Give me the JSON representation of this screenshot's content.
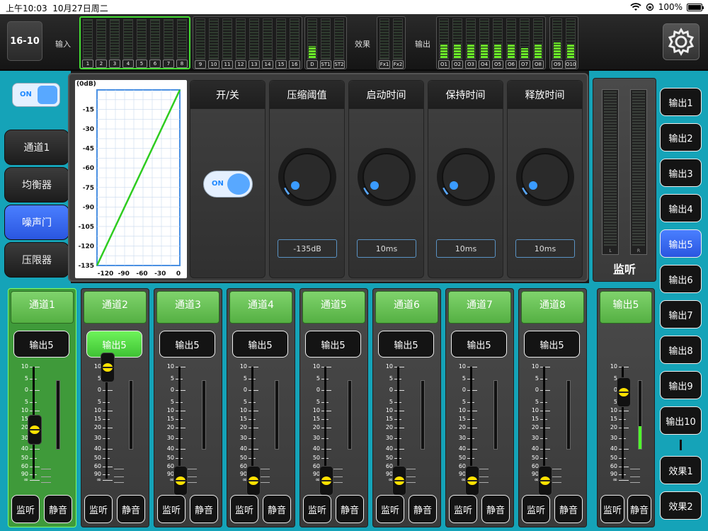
{
  "status": {
    "time": "上午10:03",
    "date": "10月27日周二",
    "battery": "100%"
  },
  "header": {
    "model": "16-10",
    "input_label": "输入",
    "fx_label": "效果",
    "output_label": "输出",
    "input_group1": [
      {
        "label": "1",
        "level": 0
      },
      {
        "label": "2",
        "level": 0
      },
      {
        "label": "3",
        "level": 0
      },
      {
        "label": "4",
        "level": 0
      },
      {
        "label": "5",
        "level": 0
      },
      {
        "label": "6",
        "level": 0
      },
      {
        "label": "7",
        "level": 0
      },
      {
        "label": "8",
        "level": 0
      }
    ],
    "input_group2": [
      {
        "label": "9",
        "level": 0
      },
      {
        "label": "10",
        "level": 0
      },
      {
        "label": "11",
        "level": 0
      },
      {
        "label": "12",
        "level": 0
      },
      {
        "label": "13",
        "level": 0
      },
      {
        "label": "14",
        "level": 0
      },
      {
        "label": "15",
        "level": 0
      },
      {
        "label": "16",
        "level": 0
      }
    ],
    "input_group3": [
      {
        "label": "D",
        "level": 0.3
      },
      {
        "label": "ST1",
        "level": 0
      },
      {
        "label": "ST2",
        "level": 0
      }
    ],
    "fx_group": [
      {
        "label": "Fx1",
        "level": 0
      },
      {
        "label": "Fx2",
        "level": 0
      }
    ],
    "output_group1": [
      {
        "label": "O1",
        "level": 0.35
      },
      {
        "label": "O2",
        "level": 0.35
      },
      {
        "label": "O3",
        "level": 0.35
      },
      {
        "label": "O4",
        "level": 0.35
      },
      {
        "label": "O5",
        "level": 0.35
      },
      {
        "label": "O6",
        "level": 0.35
      },
      {
        "label": "O7",
        "level": 0.25
      },
      {
        "label": "O8",
        "level": 0.35
      }
    ],
    "output_group2": [
      {
        "label": "O9",
        "level": 0.4
      },
      {
        "label": "O10",
        "level": 0.35
      }
    ]
  },
  "left_nav": {
    "toggle_label": "ON",
    "items": [
      "通道1",
      "均衡器",
      "噪声门",
      "压限器"
    ],
    "active_index": 2
  },
  "graph": {
    "y_ticks": [
      "(0dB)",
      "-15",
      "-30",
      "-45",
      "-60",
      "-75",
      "-90",
      "-105",
      "-120",
      "-135"
    ],
    "x_ticks": [
      "-120",
      "-90",
      "-60",
      "-30",
      "0"
    ]
  },
  "params": {
    "onoff_title": "开/关",
    "onoff_toggle": "ON",
    "knobs": [
      {
        "title": "压缩阈值",
        "value": "-135dB"
      },
      {
        "title": "启动时间",
        "value": "10ms"
      },
      {
        "title": "保持时间",
        "value": "10ms"
      },
      {
        "title": "释放时间",
        "value": "10ms"
      }
    ]
  },
  "fader_scale": [
    "10",
    "5",
    "0",
    "5",
    "10",
    "15",
    "20",
    "30",
    "40",
    "50",
    "60",
    "90",
    "∞"
  ],
  "strips": [
    {
      "name": "通道1",
      "out": "输出5",
      "out_active": false,
      "fader": 0.55,
      "listen": "监听",
      "mute": "静音",
      "selected": true
    },
    {
      "name": "通道2",
      "out": "输出5",
      "out_active": true,
      "fader": 0.0,
      "listen": "监听",
      "mute": "静音",
      "selected": false
    },
    {
      "name": "通道3",
      "out": "输出5",
      "out_active": false,
      "fader": 1.0,
      "listen": "监听",
      "mute": "静音",
      "selected": false
    },
    {
      "name": "通道4",
      "out": "输出5",
      "out_active": false,
      "fader": 1.0,
      "listen": "监听",
      "mute": "静音",
      "selected": false
    },
    {
      "name": "通道5",
      "out": "输出5",
      "out_active": false,
      "fader": 1.0,
      "listen": "监听",
      "mute": "静音",
      "selected": false
    },
    {
      "name": "通道6",
      "out": "输出5",
      "out_active": false,
      "fader": 1.0,
      "listen": "监听",
      "mute": "静音",
      "selected": false
    },
    {
      "name": "通道7",
      "out": "输出5",
      "out_active": false,
      "fader": 1.0,
      "listen": "监听",
      "mute": "静音",
      "selected": false
    },
    {
      "name": "通道8",
      "out": "输出5",
      "out_active": false,
      "fader": 1.0,
      "listen": "监听",
      "mute": "静音",
      "selected": false
    }
  ],
  "monitor": {
    "title": "监听",
    "left": "L",
    "right": "R",
    "strip": {
      "name": "输出5",
      "fader": 0.22,
      "level": 0.33,
      "listen": "监听",
      "mute": "静音"
    }
  },
  "outputs": {
    "items": [
      "输出1",
      "输出2",
      "输出3",
      "输出4",
      "输出5",
      "输出6",
      "输出7",
      "输出8",
      "输出9",
      "输出10"
    ],
    "active_index": 4,
    "fx": [
      "效果1",
      "效果2"
    ]
  }
}
